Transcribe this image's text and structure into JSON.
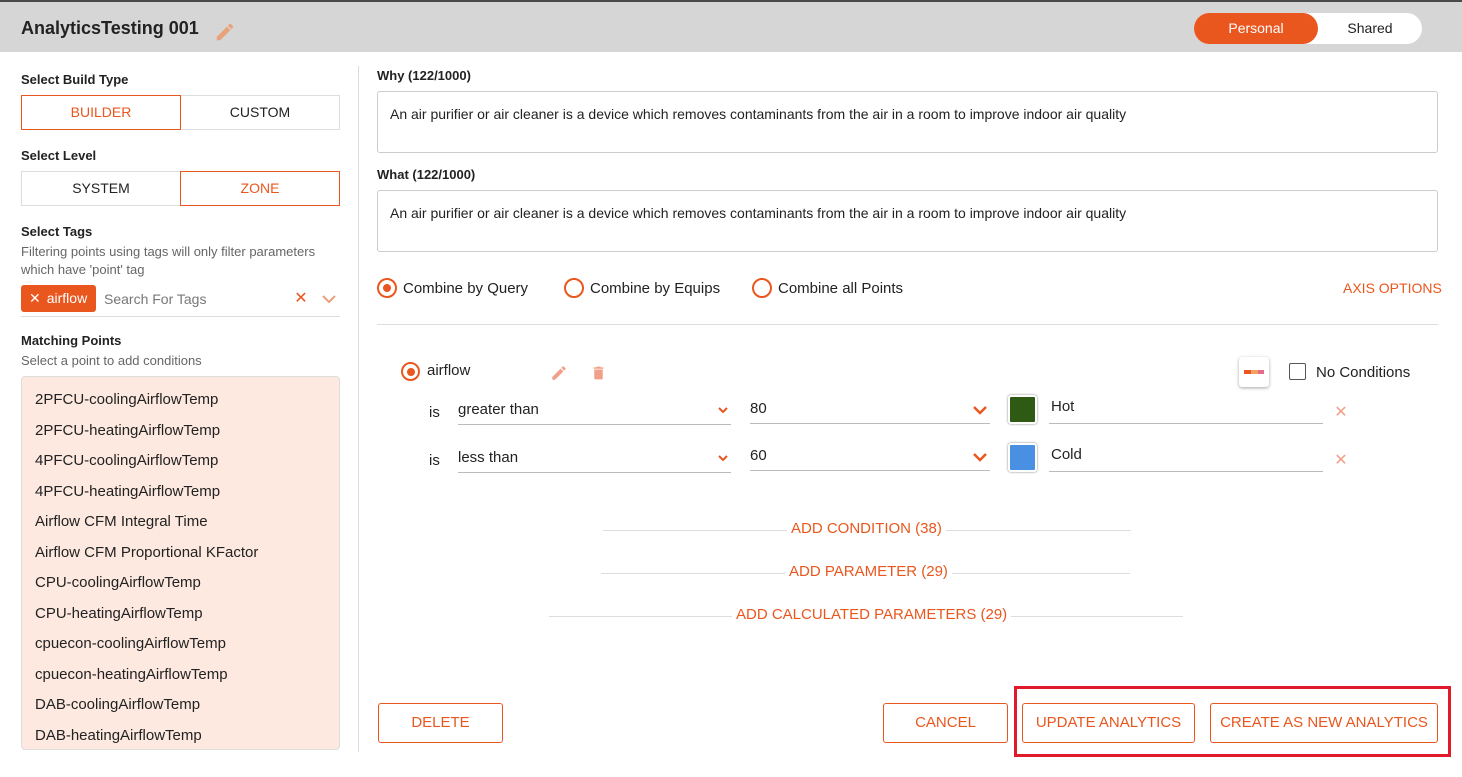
{
  "header": {
    "title": "AnalyticsTesting 001",
    "toggle": {
      "personal_label": "Personal",
      "shared_label": "Shared",
      "selected": "Personal"
    }
  },
  "sidebar": {
    "build_type": {
      "label": "Select Build Type",
      "options": [
        "BUILDER",
        "CUSTOM"
      ],
      "selected": "BUILDER"
    },
    "level": {
      "label": "Select Level",
      "options": [
        "SYSTEM",
        "ZONE"
      ],
      "selected": "ZONE"
    },
    "tags": {
      "label": "Select Tags",
      "hint_line1": "Filtering points using tags will only filter parameters",
      "hint_line2": "which have 'point' tag",
      "chips": [
        {
          "label": "airflow"
        }
      ],
      "search_placeholder": "Search For Tags"
    },
    "matching_points": {
      "label": "Matching Points",
      "hint": "Select a point to add conditions",
      "items": [
        "2PFCU-coolingAirflowTemp",
        "2PFCU-heatingAirflowTemp",
        "4PFCU-coolingAirflowTemp",
        "4PFCU-heatingAirflowTemp",
        "Airflow CFM Integral Time",
        "Airflow CFM Proportional KFactor",
        "CPU-coolingAirflowTemp",
        "CPU-heatingAirflowTemp",
        "cpuecon-coolingAirflowTemp",
        "cpuecon-heatingAirflowTemp",
        "DAB-coolingAirflowTemp",
        "DAB-heatingAirflowTemp"
      ]
    }
  },
  "main": {
    "why": {
      "label": "Why (122/1000)",
      "value": "An air purifier or air cleaner is a device which removes contaminants from the air in a room to improve indoor air quality"
    },
    "what": {
      "label": "What (122/1000)",
      "value": "An air purifier or air cleaner is a device which removes contaminants from the air in a room to improve indoor air quality"
    },
    "combine": {
      "options": [
        "Combine by Query",
        "Combine by Equips",
        "Combine all Points"
      ],
      "selected": "Combine by Query"
    },
    "axis_options_label": "AXIS OPTIONS",
    "parameter": {
      "name": "airflow",
      "no_conditions_label": "No Conditions",
      "conditions": [
        {
          "is_label": "is",
          "operator": "greater than",
          "value": "80",
          "color": "#2f5a13",
          "label": "Hot"
        },
        {
          "is_label": "is",
          "operator": "less than",
          "value": "60",
          "color": "#4a90e2",
          "label": "Cold"
        }
      ]
    },
    "add_condition_label": "ADD CONDITION (38)",
    "add_parameter_label": "ADD PARAMETER (29)",
    "add_calculated_label": "ADD CALCULATED PARAMETERS (29)"
  },
  "footer": {
    "delete_label": "DELETE",
    "cancel_label": "CANCEL",
    "update_label": "UPDATE ANALYTICS",
    "create_label": "CREATE AS NEW ANALYTICS"
  },
  "colors": {
    "accent": "#e9571e",
    "highlight_frame": "#e0192b",
    "points_bg": "#fde9e0"
  }
}
